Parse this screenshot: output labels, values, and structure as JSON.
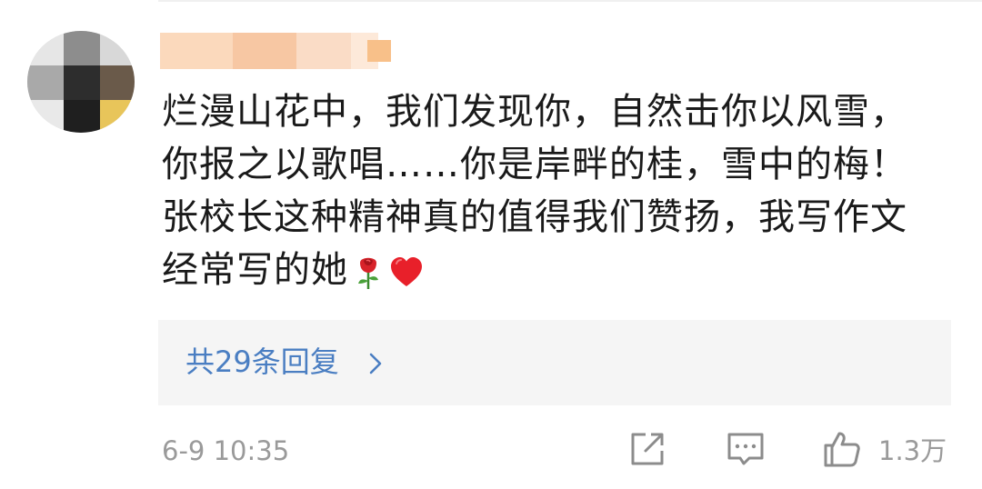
{
  "comment": {
    "username": "",
    "lines": [
      "烂漫山花中，我们发现你，自然击你以风雪，",
      "你报之以歌唱……你是岸畔的桂，雪中的梅！",
      "张校长这种精神真的值得我们赞扬，我写作文",
      "经常写的她"
    ],
    "emojis": [
      "rose-emoji",
      "red-heart-emoji"
    ],
    "timestamp": "6-9 10:35"
  },
  "replies": {
    "label": "共29条回复"
  },
  "actions": {
    "share_icon": "share-icon",
    "comment_icon": "comment-icon",
    "like_icon": "thumbs-up-icon",
    "like_count": "1.3万"
  },
  "colors": {
    "reply_link": "#4a7ec2",
    "meta_text": "#9a9a9a",
    "reply_box_bg": "#f5f5f5",
    "username_blur": "#f8c8a0"
  }
}
